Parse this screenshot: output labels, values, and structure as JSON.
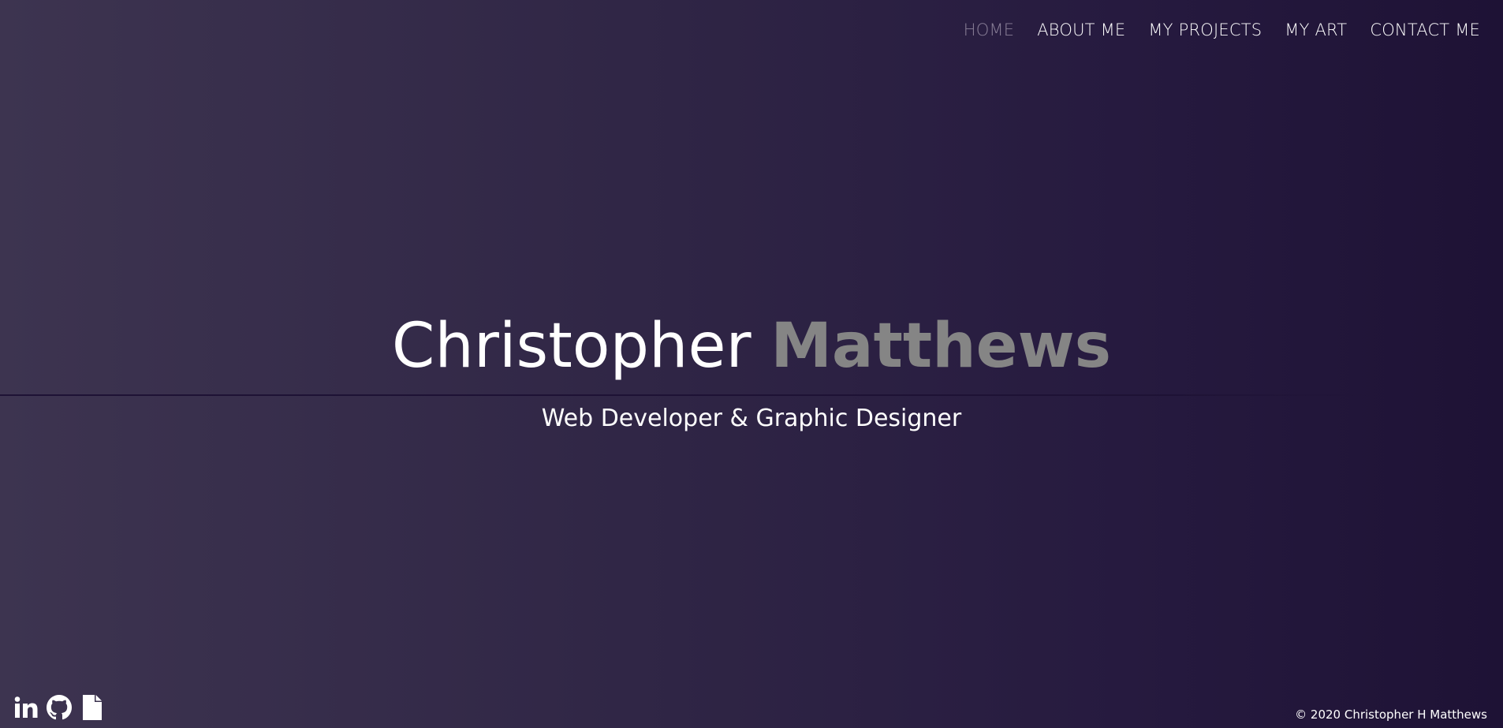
{
  "nav": {
    "items": [
      {
        "label": "HOME",
        "active": true
      },
      {
        "label": "ABOUT ME",
        "active": false
      },
      {
        "label": "MY PROJECTS",
        "active": false
      },
      {
        "label": "MY ART",
        "active": false
      },
      {
        "label": "CONTACT ME",
        "active": false
      }
    ]
  },
  "hero": {
    "first_name": "Christopher",
    "last_name": "Matthews",
    "subtitle": "Web Developer & Graphic Designer"
  },
  "social": {
    "icons": [
      "linkedin-icon",
      "github-icon",
      "document-icon"
    ]
  },
  "footer": {
    "copyright": "© 2020 Christopher H Matthews"
  },
  "colors": {
    "text": "#ffffff",
    "active_nav": "#8a8098",
    "last_name": "#858585",
    "background_start": "#3d3450",
    "background_end": "#1e1235"
  }
}
